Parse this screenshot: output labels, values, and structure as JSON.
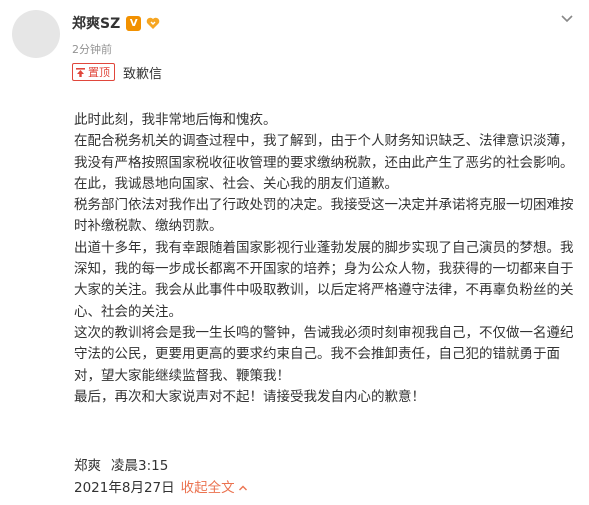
{
  "post": {
    "author": "郑爽SZ",
    "verified_icon": "v-verified-icon",
    "fan_icon": "fan-badge-icon",
    "time": "2分钟前",
    "pin_label": "置顶",
    "title": "致歉信",
    "paragraphs": [
      "此时此刻，我非常地后悔和愧疚。",
      "在配合税务机关的调查过程中，我了解到，由于个人财务知识缺乏、法律意识淡薄，我没有严格按照国家税收征收管理的要求缴纳税款，还由此产生了恶劣的社会影响。在此，我诚恳地向国家、社会、关心我的朋友们道歉。",
      "税务部门依法对我作出了行政处罚的决定。我接受这一决定并承诺将克服一切困难按时补缴税款、缴纳罚款。",
      "出道十多年，我有幸跟随着国家影视行业蓬勃发展的脚步实现了自己演员的梦想。我深知，我的每一步成长都离不开国家的培养；身为公众人物，我获得的一切都来自于大家的关注。我会从此事件中吸取教训，以后定将严格遵守法律，不再辜负粉丝的关心、社会的关注。",
      "这次的教训将会是我一生长鸣的警钟，告诫我必须时刻审视我自己，不仅做一名遵纪守法的公民，更要用更高的要求约束自己。我不会推卸责任，自己犯的错就勇于面对，望大家能继续监督我、鞭策我！",
      "最后，再次和大家说声对不起！请接受我发自内心的歉意！"
    ],
    "signature_name": "郑爽",
    "signature_time": "凌晨3:15",
    "date": "2021年8月27日",
    "collapse_label": "收起全文",
    "accent_color": "#eb7350"
  }
}
